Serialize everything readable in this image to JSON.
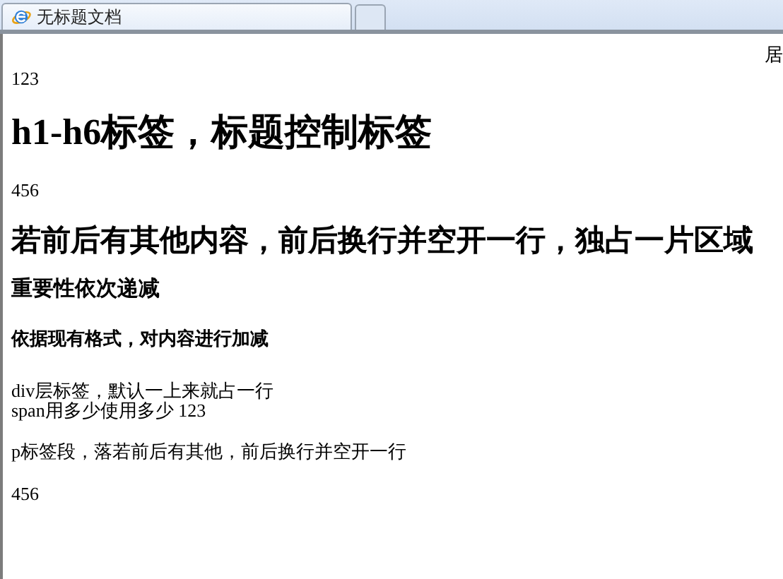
{
  "tabs": [
    {
      "title": "无标题文档",
      "selected": true
    }
  ],
  "content": [
    {
      "kind": "corner",
      "text": "居"
    },
    {
      "kind": "plain",
      "text": "123"
    },
    {
      "kind": "h1",
      "text": "h1-h6标签，标题控制标签"
    },
    {
      "kind": "para",
      "text": "456"
    },
    {
      "kind": "h2",
      "text": "若前后有其他内容，前后换行并空开一行，独占一片区域"
    },
    {
      "kind": "h3",
      "text": "重要性依次递减"
    },
    {
      "kind": "h4",
      "text": "依据现有格式，对内容进行加减"
    },
    {
      "kind": "plain",
      "text": "div层标签，默认一上来就占一行"
    },
    {
      "kind": "plain",
      "text": "span用多少使用多少 123"
    },
    {
      "kind": "para",
      "text": "p标签段，落若前后有其他，前后换行并空开一行"
    },
    {
      "kind": "para",
      "text": "456"
    }
  ]
}
